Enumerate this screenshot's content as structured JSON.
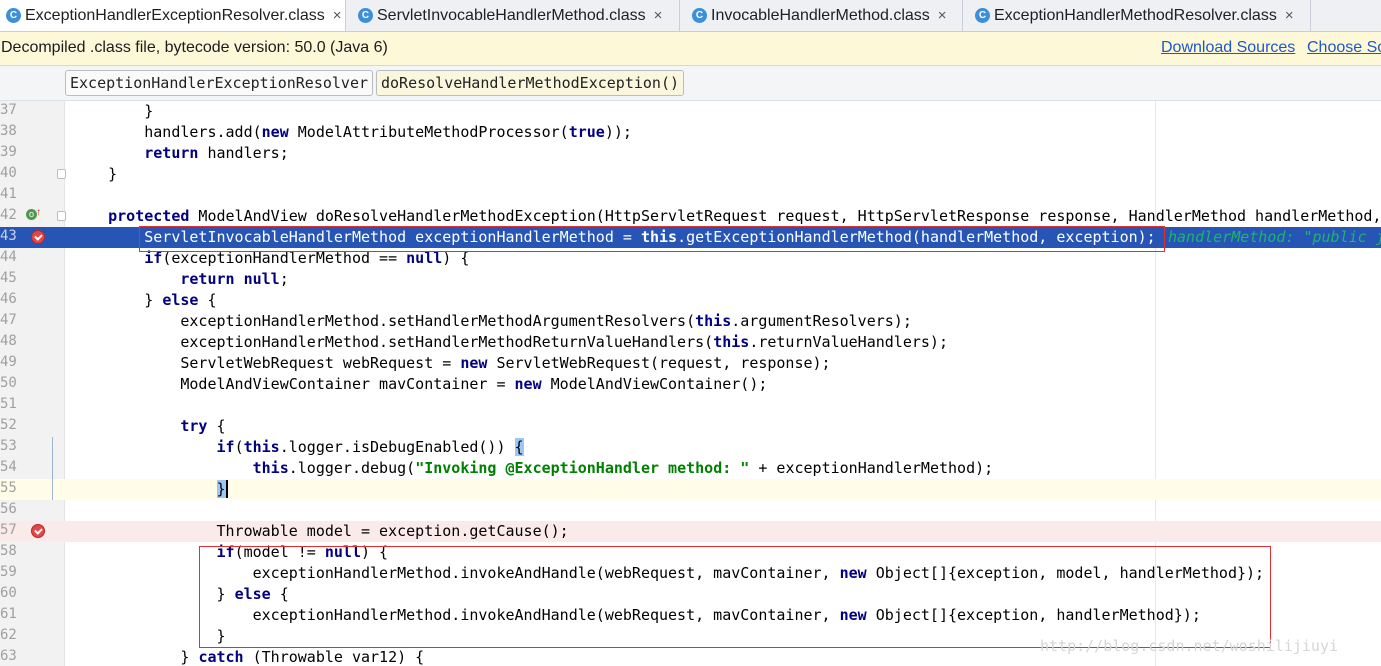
{
  "tabs": [
    {
      "label": "ExceptionHandlerExceptionResolver.class",
      "active": true
    },
    {
      "label": "ServletInvocableHandlerMethod.class",
      "active": false
    },
    {
      "label": "InvocableHandlerMethod.class",
      "active": false
    },
    {
      "label": "ExceptionHandlerMethodResolver.class",
      "active": false
    }
  ],
  "tab_close_glyph": "×",
  "notice": {
    "message": "Decompiled .class file, bytecode version: 50.0 (Java 6)",
    "download_sources": "Download Sources",
    "choose_sources": "Choose So"
  },
  "breadcrumb": {
    "class_name": "ExceptionHandlerExceptionResolver",
    "method_name": "doResolveHandlerMethodException()"
  },
  "editor": {
    "line_numbers": [
      "37",
      "38",
      "39",
      "40",
      "41",
      "42",
      "43",
      "44",
      "45",
      "46",
      "47",
      "48",
      "49",
      "50",
      "51",
      "52",
      "53",
      "54",
      "55",
      "56",
      "57",
      "58",
      "59",
      "60",
      "61",
      "62",
      "63"
    ],
    "inline_hint": "handlerMethod: \"public j",
    "watermark": "http://blog.csdn.net/woshilijiuyi"
  },
  "colors": {
    "execution_line": "#2655b5",
    "breakpoint": "#e0484a",
    "keyword": "#000080",
    "string": "#008000",
    "hint": "#1fb36d",
    "annotation_box": "#e03030"
  }
}
